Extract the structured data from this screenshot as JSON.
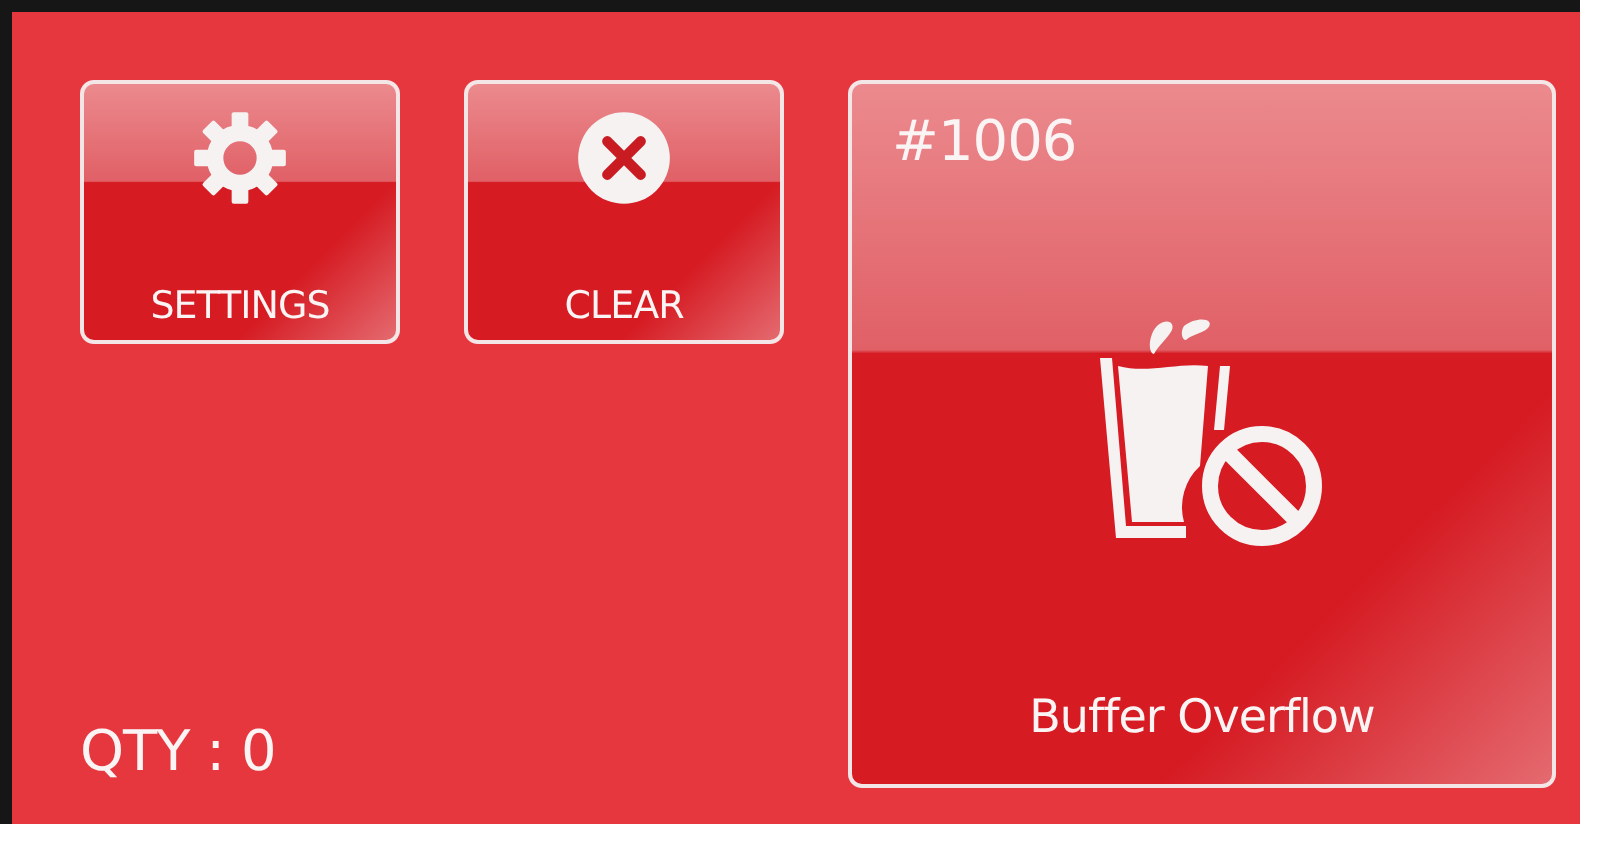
{
  "buttons": [
    {
      "kind": "settings",
      "label": "SETTINGS"
    },
    {
      "kind": "clear",
      "label": "CLEAR"
    }
  ],
  "quantity": "QTY : 0",
  "alert": {
    "code": "#1006",
    "message": "Buffer Overflow"
  }
}
